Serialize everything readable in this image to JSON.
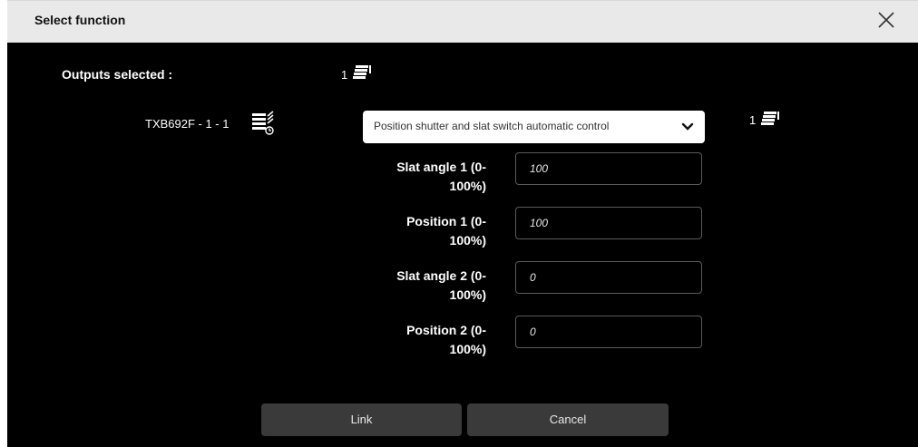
{
  "dialog": {
    "title": "Select function",
    "close_icon": "close-icon"
  },
  "summary": {
    "outputs_label": "Outputs selected :",
    "outputs_count": "1",
    "outputs_icon": "blind-stack-icon"
  },
  "device": {
    "name": "TXB692F - 1 - 1",
    "icon": "shutter-auto-icon",
    "function_select": "Position shutter and slat switch automatic control",
    "function_count": "1",
    "function_icon": "blind-stack-icon"
  },
  "fields": [
    {
      "label_line1": "Slat angle 1 (0-",
      "label_line2": "100%)",
      "value": "100"
    },
    {
      "label_line1": "Position 1 (0-",
      "label_line2": "100%)",
      "value": "100"
    },
    {
      "label_line1": "Slat angle 2 (0-",
      "label_line2": "100%)",
      "value": "0"
    },
    {
      "label_line1": "Position 2 (0-",
      "label_line2": "100%)",
      "value": "0"
    }
  ],
  "buttons": {
    "link": "Link",
    "cancel": "Cancel"
  },
  "colors": {
    "title_bar": "#e9e9e9",
    "background": "#000000",
    "button": "#3a3a3a"
  }
}
